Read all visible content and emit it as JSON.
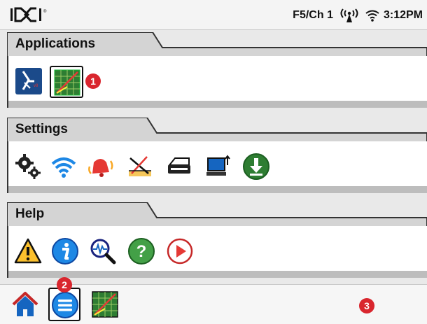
{
  "status_bar": {
    "logo_text": "DCI",
    "frequency_channel": "F5/Ch 1",
    "time": "3:12PM",
    "icons": [
      "signal-antenna-icon",
      "wifi-icon"
    ]
  },
  "sections": [
    {
      "title": "Applications",
      "icons": [
        "locate-app-icon",
        "target-steering-app-icon"
      ],
      "selected_icon": "target-steering-app-icon"
    },
    {
      "title": "Settings",
      "icons": [
        "gear-settings-icon",
        "wireless-icon",
        "alert-volume-icon",
        "pitch-settings-icon",
        "printer-icon",
        "computer-transfer-icon",
        "download-icon"
      ]
    },
    {
      "title": "Help",
      "icons": [
        "warning-icon",
        "info-icon",
        "diagnostics-icon",
        "help-icon",
        "play-video-icon"
      ]
    }
  ],
  "bottom_bar": {
    "icons": [
      "home-icon",
      "menu-icon",
      "target-steering-icon"
    ],
    "selected_icon": "menu-icon"
  },
  "callouts": [
    "1",
    "2",
    "3"
  ],
  "colors": {
    "callout": "#d9262e",
    "background": "#e9e9e9",
    "tab": "#d4d4d4",
    "strip": "#bdbdbd"
  }
}
